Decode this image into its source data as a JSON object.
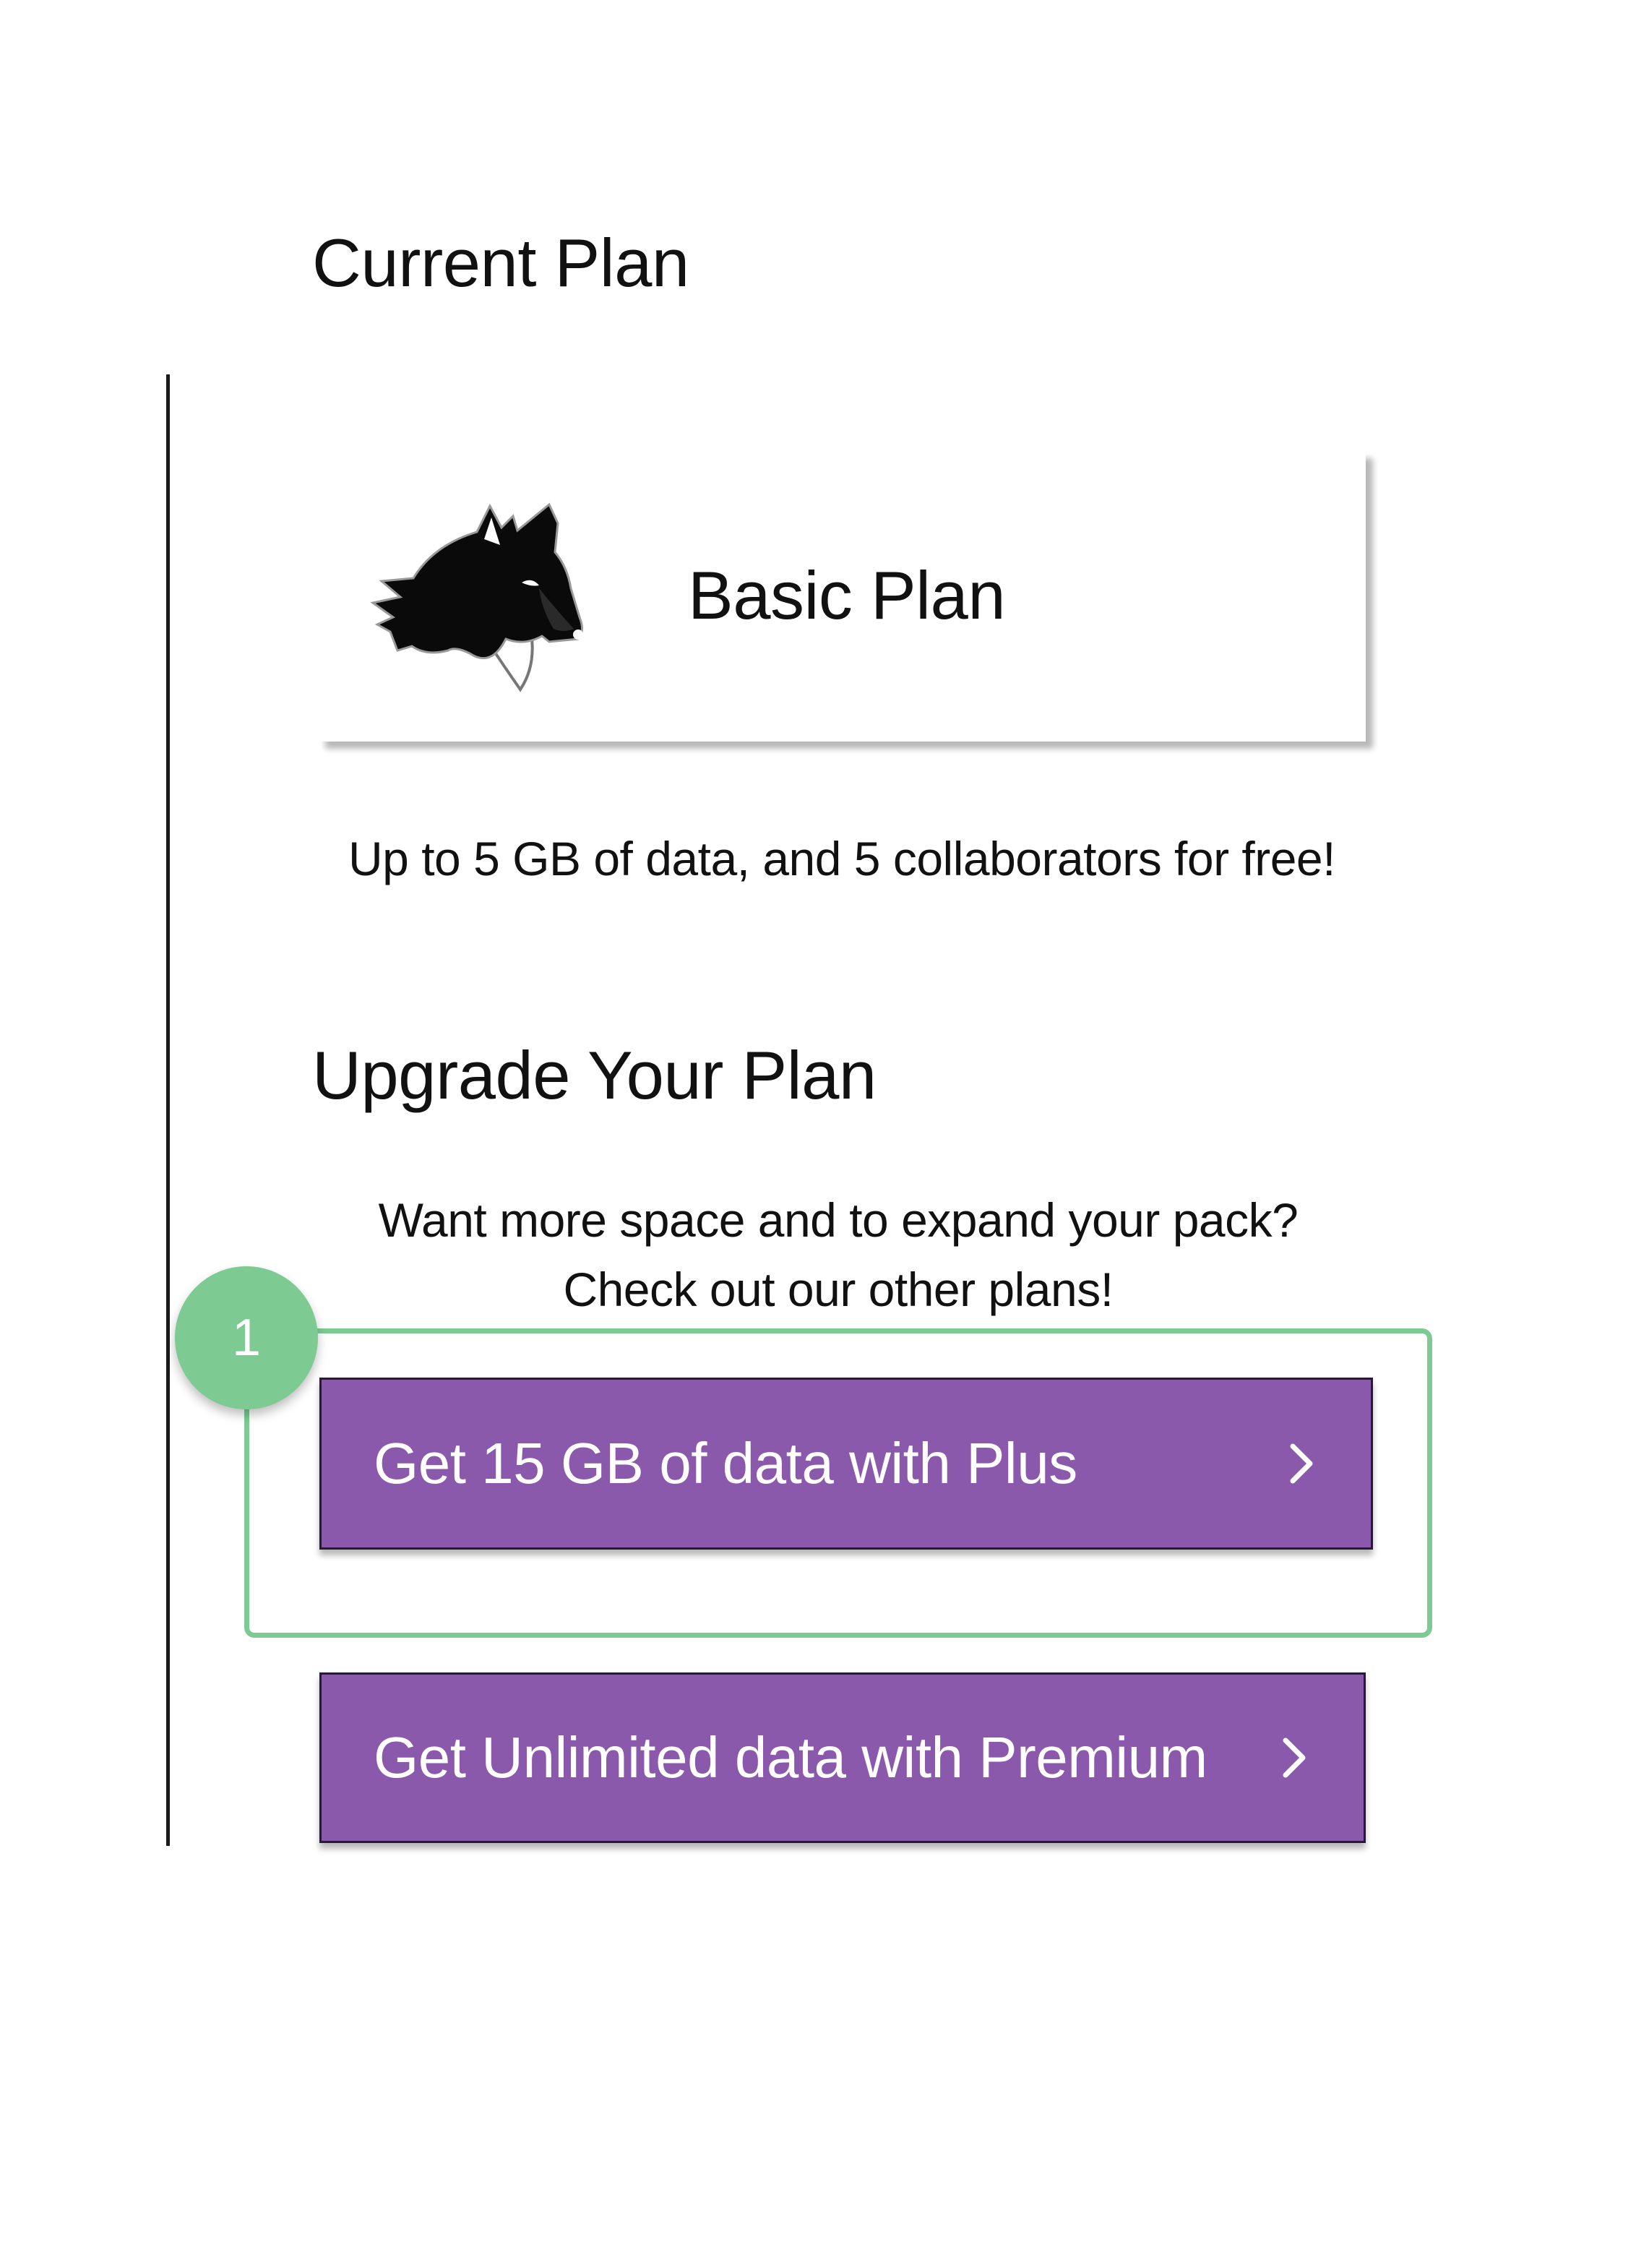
{
  "current_plan": {
    "heading": "Current Plan",
    "plan_name": "Basic Plan",
    "description": "Up to 5 GB of data, and 5 collaborators for free!"
  },
  "upgrade": {
    "heading": "Upgrade Your Plan",
    "description": "Want more space and to expand your pack? Check out our other plans!",
    "step_badge": "1",
    "buttons": [
      {
        "label": "Get 15 GB of data with Plus"
      },
      {
        "label": "Get Unlimited data with Premium"
      }
    ]
  },
  "colors": {
    "button_purple": "#8b59ab",
    "highlight_green": "#7dcb93"
  },
  "icons": {
    "logo": "wolf-head-icon",
    "button_arrow": "chevron-right-icon"
  }
}
